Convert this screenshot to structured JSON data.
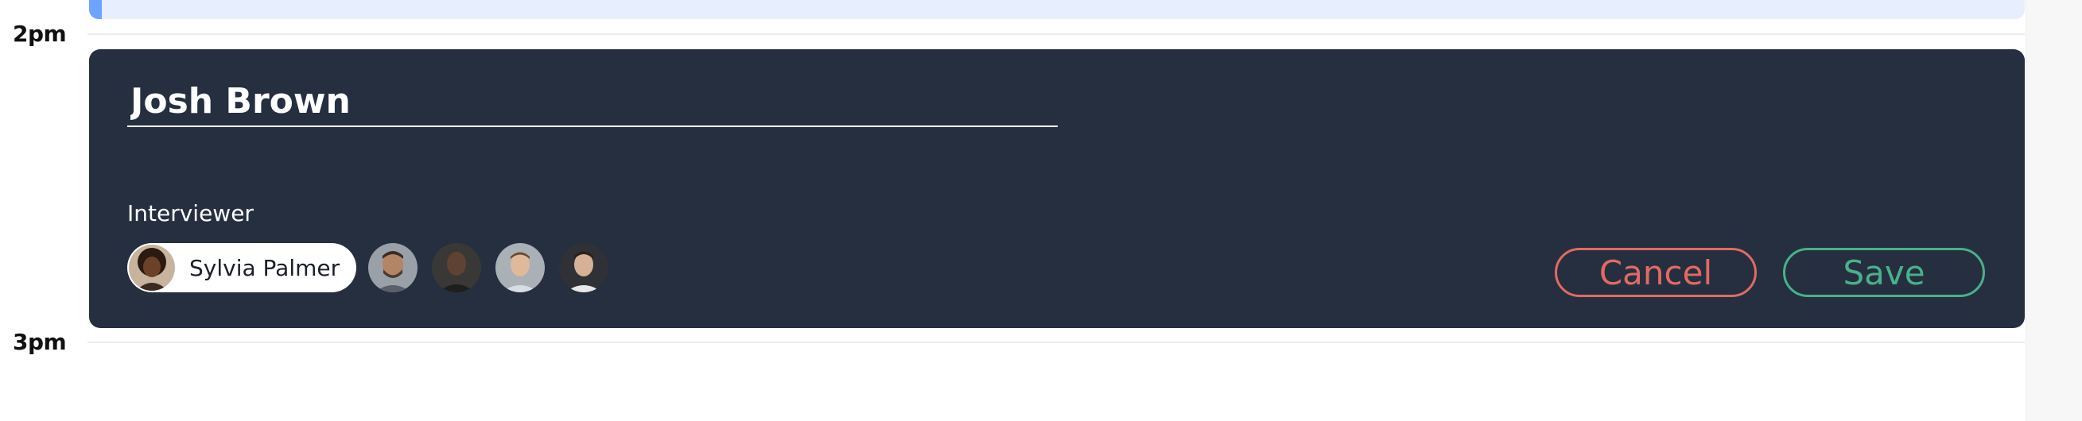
{
  "calendar": {
    "time_slots": [
      "2pm",
      "3pm"
    ]
  },
  "editor": {
    "title_value": "Josh Brown",
    "interviewer_label": "Interviewer",
    "selected_interviewer": {
      "name": "Sylvia Palmer",
      "icon": "avatar-photo-icon"
    },
    "other_interviewers": [
      {
        "icon": "avatar-photo-icon"
      },
      {
        "icon": "avatar-photo-icon"
      },
      {
        "icon": "avatar-photo-icon"
      },
      {
        "icon": "avatar-photo-icon"
      }
    ],
    "cancel_label": "Cancel",
    "save_label": "Save"
  },
  "colors": {
    "editor_bg": "#252f40",
    "cancel": "#e26a63",
    "save": "#4ab08a",
    "previous_event_bg": "#e7efff",
    "previous_event_accent": "#6ea3ff"
  }
}
